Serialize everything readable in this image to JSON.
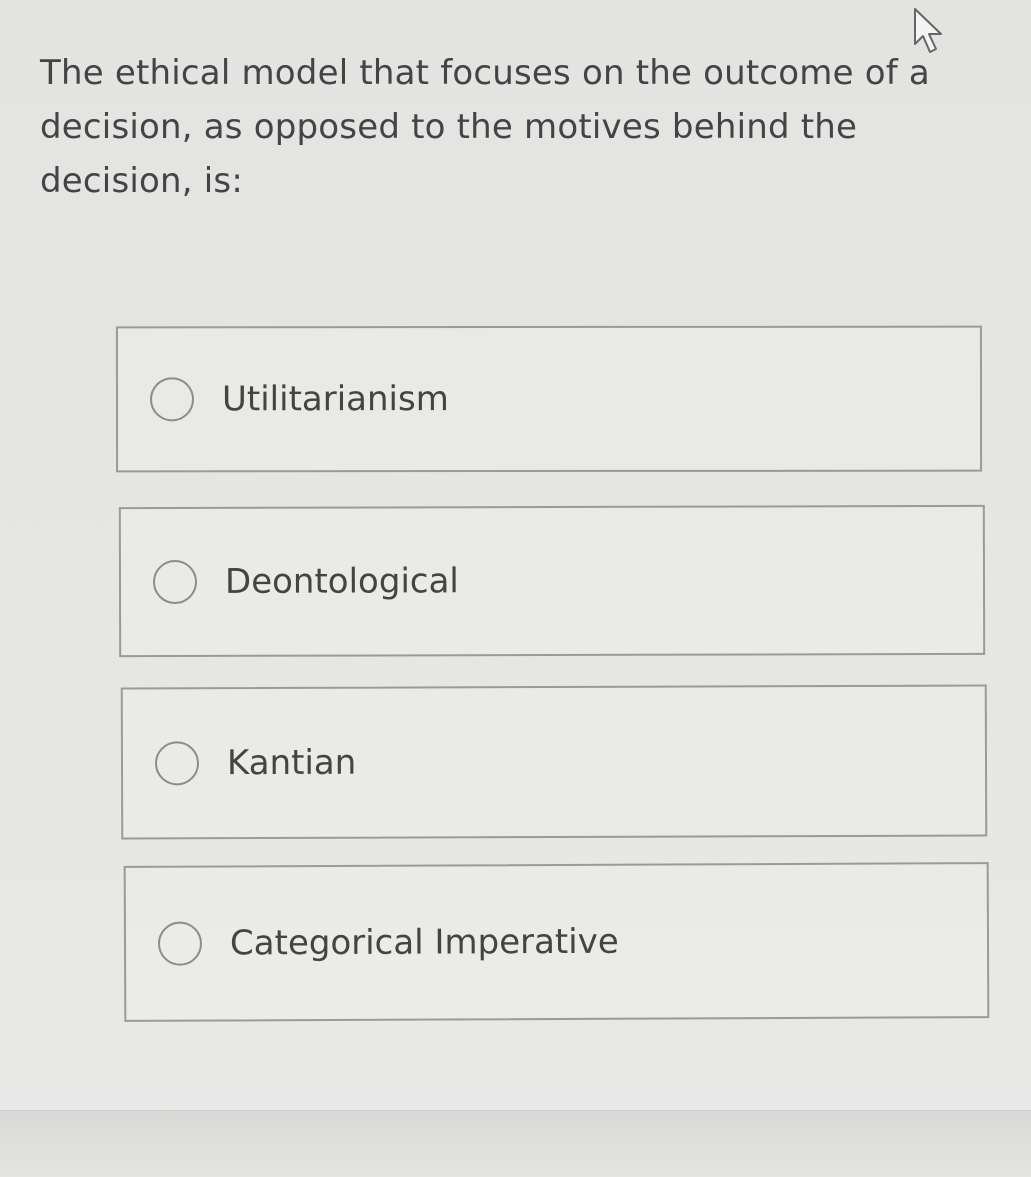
{
  "question": {
    "text": "The ethical model that focuses on the outcome of a decision, as opposed to the motives behind the decision, is:"
  },
  "options": [
    {
      "label": "Utilitarianism",
      "selected": false
    },
    {
      "label": "Deontological",
      "selected": false
    },
    {
      "label": "Kantian",
      "selected": false
    },
    {
      "label": "Categorical Imperative",
      "selected": false
    }
  ],
  "cursor": {
    "icon": "arrow-pointer-icon"
  }
}
